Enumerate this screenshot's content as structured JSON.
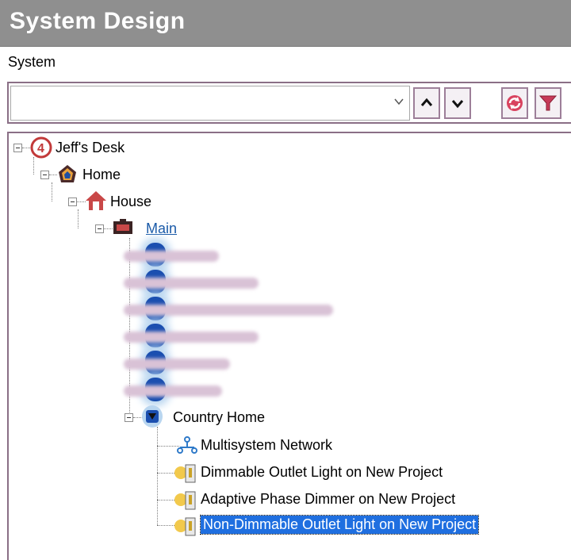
{
  "window": {
    "title": "System Design"
  },
  "toolbar": {
    "section_label": "System",
    "dropdown_value": "",
    "buttons": [
      "move-up",
      "move-down",
      "refresh",
      "filter"
    ]
  },
  "tree": {
    "root": {
      "label": "Jeff's Desk",
      "icon": "site-icon"
    },
    "home": {
      "label": "Home",
      "icon": "home-icon"
    },
    "house": {
      "label": "House",
      "icon": "house-icon"
    },
    "main": {
      "label": "Main",
      "icon": "room-icon"
    },
    "country_home": {
      "label": "Country Home",
      "icon": "room-icon"
    },
    "children": [
      {
        "label": "Multisystem Network",
        "icon": "network-icon"
      },
      {
        "label": "Dimmable Outlet Light on New Project",
        "icon": "light-switch-icon"
      },
      {
        "label": "Adaptive Phase Dimmer on New Project",
        "icon": "light-switch-icon"
      },
      {
        "label": "Non-Dimmable Outlet Light on New Project",
        "icon": "light-switch-icon",
        "selected": true
      }
    ]
  },
  "colors": {
    "titlebar": "#8f8f8f",
    "frame": "#8a6f86",
    "selection": "#1f6fe0",
    "link": "#1a5aa8"
  }
}
